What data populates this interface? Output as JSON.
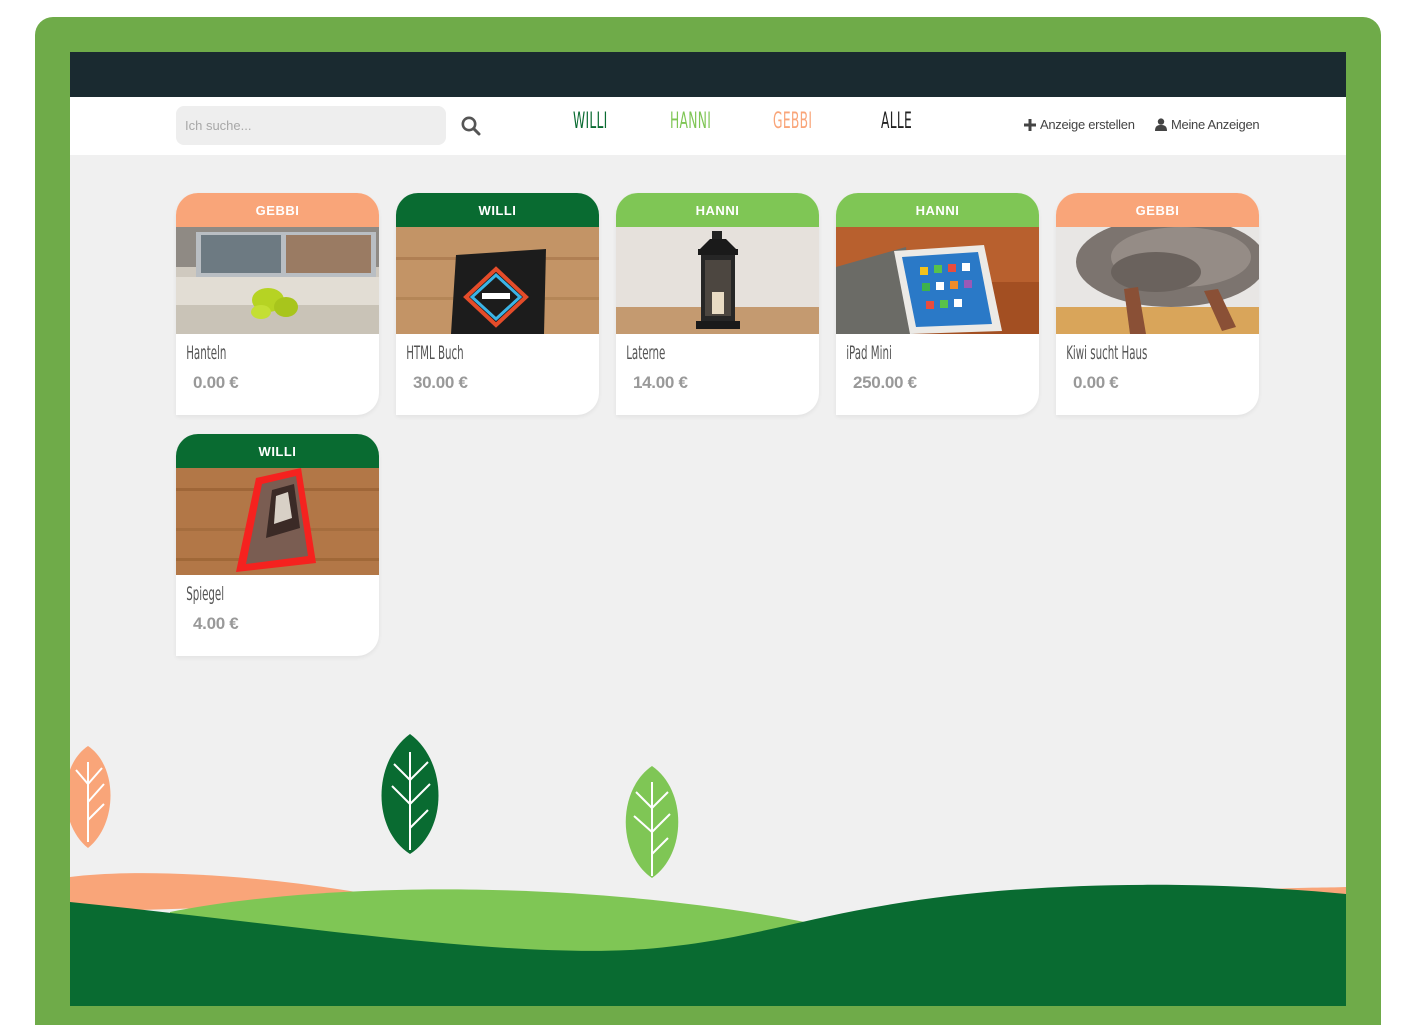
{
  "search": {
    "placeholder": "Ich suche..."
  },
  "nav": {
    "willi": "WILLI",
    "hanni": "HANNI",
    "gebbi": "GEBBI",
    "alle": "ALLE"
  },
  "actions": {
    "create": "Anzeige erstellen",
    "mine": "Meine Anzeigen"
  },
  "colors": {
    "willi": "#096b31",
    "hanni": "#7fc655",
    "gebbi": "#f9a579",
    "frame": "#6fab49",
    "topbar": "#1a2a30"
  },
  "cards": [
    {
      "badge": "GEBBI",
      "title": "Hanteln",
      "price": "0.00 €"
    },
    {
      "badge": "WILLI",
      "title": "HTML Buch",
      "price": "30.00 €"
    },
    {
      "badge": "HANNI",
      "title": "Laterne",
      "price": "14.00 €"
    },
    {
      "badge": "HANNI",
      "title": "iPad Mini",
      "price": "250.00 €"
    },
    {
      "badge": "GEBBI",
      "title": "Kiwi sucht Haus",
      "price": "0.00 €"
    },
    {
      "badge": "WILLI",
      "title": "Spiegel",
      "price": "4.00 €"
    }
  ]
}
